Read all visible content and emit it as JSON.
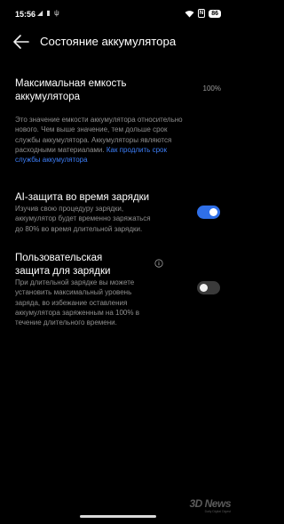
{
  "status_bar": {
    "time": "15:56",
    "battery": "86",
    "nfc": "N",
    "left_icons": [
      "telegram-icon",
      "sim-icon",
      "usb-icon"
    ],
    "right_icons": [
      "wifi-icon",
      "nfc-icon",
      "battery-icon"
    ]
  },
  "header": {
    "title": "Состояние аккумулятора"
  },
  "capacity": {
    "label_line1": "Максимальная емкость",
    "label_line2": "аккумулятора",
    "value": "100%",
    "desc_lines": [
      "Это значение емкости аккумулятора относительно",
      "нового. Чем выше значение, тем дольше срок",
      "службы аккумулятора. Аккумуляторы являются",
      "расходными материалами."
    ],
    "link_part1": "Как продлить срок",
    "link_part2": "службы аккумулятора"
  },
  "ai_protection": {
    "label": "AI-защита во время зарядки",
    "desc_lines": [
      "Изучив свою процедуру зарядки,",
      "аккумулятор будет временно заряжаться",
      "до 80% во время длительной зарядки."
    ],
    "enabled": true
  },
  "custom_protection": {
    "label_line1": "Пользовательская",
    "label_line2": "защита для зарядки",
    "desc_lines": [
      "При длительной зарядке вы можете",
      "установить максимальный уровень",
      "заряда, во избежание оставления",
      "аккумулятора заряженным на 100% в",
      "течение длительного времени."
    ],
    "enabled": false
  },
  "watermark": {
    "logo": "3D News",
    "sub": "Daily Digital Digest"
  },
  "colors": {
    "accent": "#2f6fe8",
    "link": "#3d7ef7",
    "background": "#000000"
  }
}
